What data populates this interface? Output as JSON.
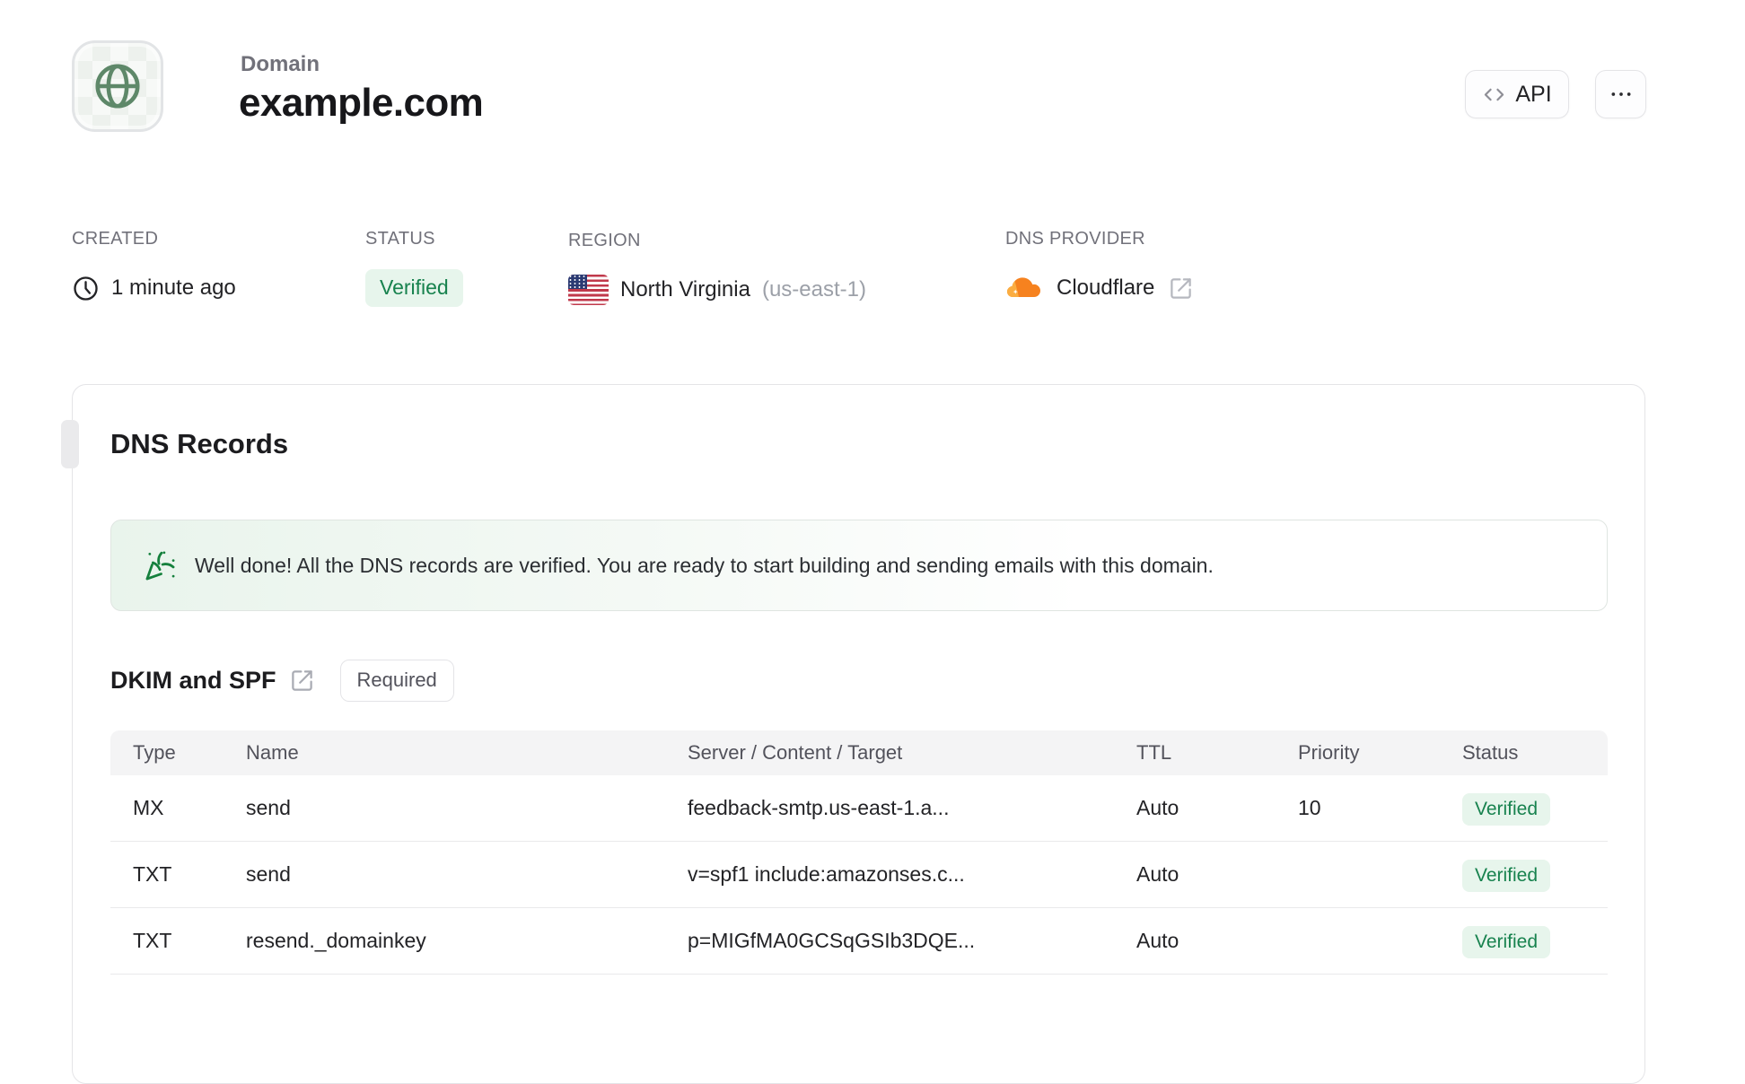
{
  "header": {
    "eyebrow": "Domain",
    "title": "example.com",
    "api_button_label": "API",
    "more_button_label": "···"
  },
  "meta": {
    "created": {
      "label": "CREATED",
      "value": "1 minute ago"
    },
    "status": {
      "label": "STATUS",
      "value": "Verified"
    },
    "region": {
      "label": "REGION",
      "value": "North Virginia",
      "code": "(us-east-1)"
    },
    "dns_provider": {
      "label": "DNS PROVIDER",
      "value": "Cloudflare"
    }
  },
  "dns_records": {
    "title": "DNS Records",
    "banner_text": "Well done! All the DNS records are verified. You are ready to start building and sending emails with this domain.",
    "section": {
      "title": "DKIM and SPF",
      "badge": "Required"
    },
    "table": {
      "headers": [
        "Type",
        "Name",
        "Server / Content / Target",
        "TTL",
        "Priority",
        "Status"
      ],
      "rows": [
        {
          "type": "MX",
          "name": "send",
          "content": "feedback-smtp.us-east-1.a...",
          "ttl": "Auto",
          "priority": "10",
          "status": "Verified"
        },
        {
          "type": "TXT",
          "name": "send",
          "content": "v=spf1 include:amazonses.c...",
          "ttl": "Auto",
          "priority": "",
          "status": "Verified"
        },
        {
          "type": "TXT",
          "name": "resend._domainkey",
          "content": "p=MIGfMA0GCSqGSIb3DQE...",
          "ttl": "Auto",
          "priority": "",
          "status": "Verified"
        }
      ]
    }
  },
  "colors": {
    "accent_green_text": "#17824e",
    "accent_green_bg": "#e7f5ec",
    "cloudflare_orange": "#f6821f",
    "globe_green": "#5e8869",
    "border": "#e4e4e7",
    "table_header_bg": "#f4f4f5",
    "label_gray": "#71717a"
  }
}
